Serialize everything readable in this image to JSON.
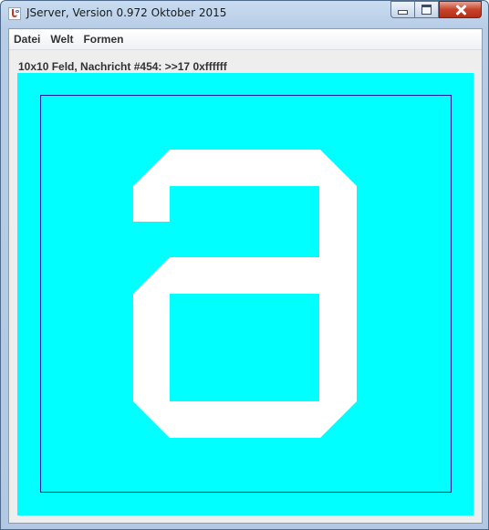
{
  "window": {
    "title": "JServer, Version 0.972 Oktober 2015",
    "app_icon": "java-cup-icon",
    "controls": {
      "minimize_icon": "minimize-icon",
      "maximize_icon": "maximize-icon",
      "close_icon": "close-icon"
    }
  },
  "menu": {
    "items": [
      {
        "label": "Datei"
      },
      {
        "label": "Welt"
      },
      {
        "label": "Formen"
      }
    ]
  },
  "status": {
    "text": "10x10 Feld, Nachricht #454: >>17 0xffffff"
  },
  "board": {
    "grid_size": "10x10",
    "background_color": "#00ffff",
    "border_color": "#1a1aa8",
    "glyph_color": "#ffffff",
    "glyph_shape": "letter a"
  }
}
